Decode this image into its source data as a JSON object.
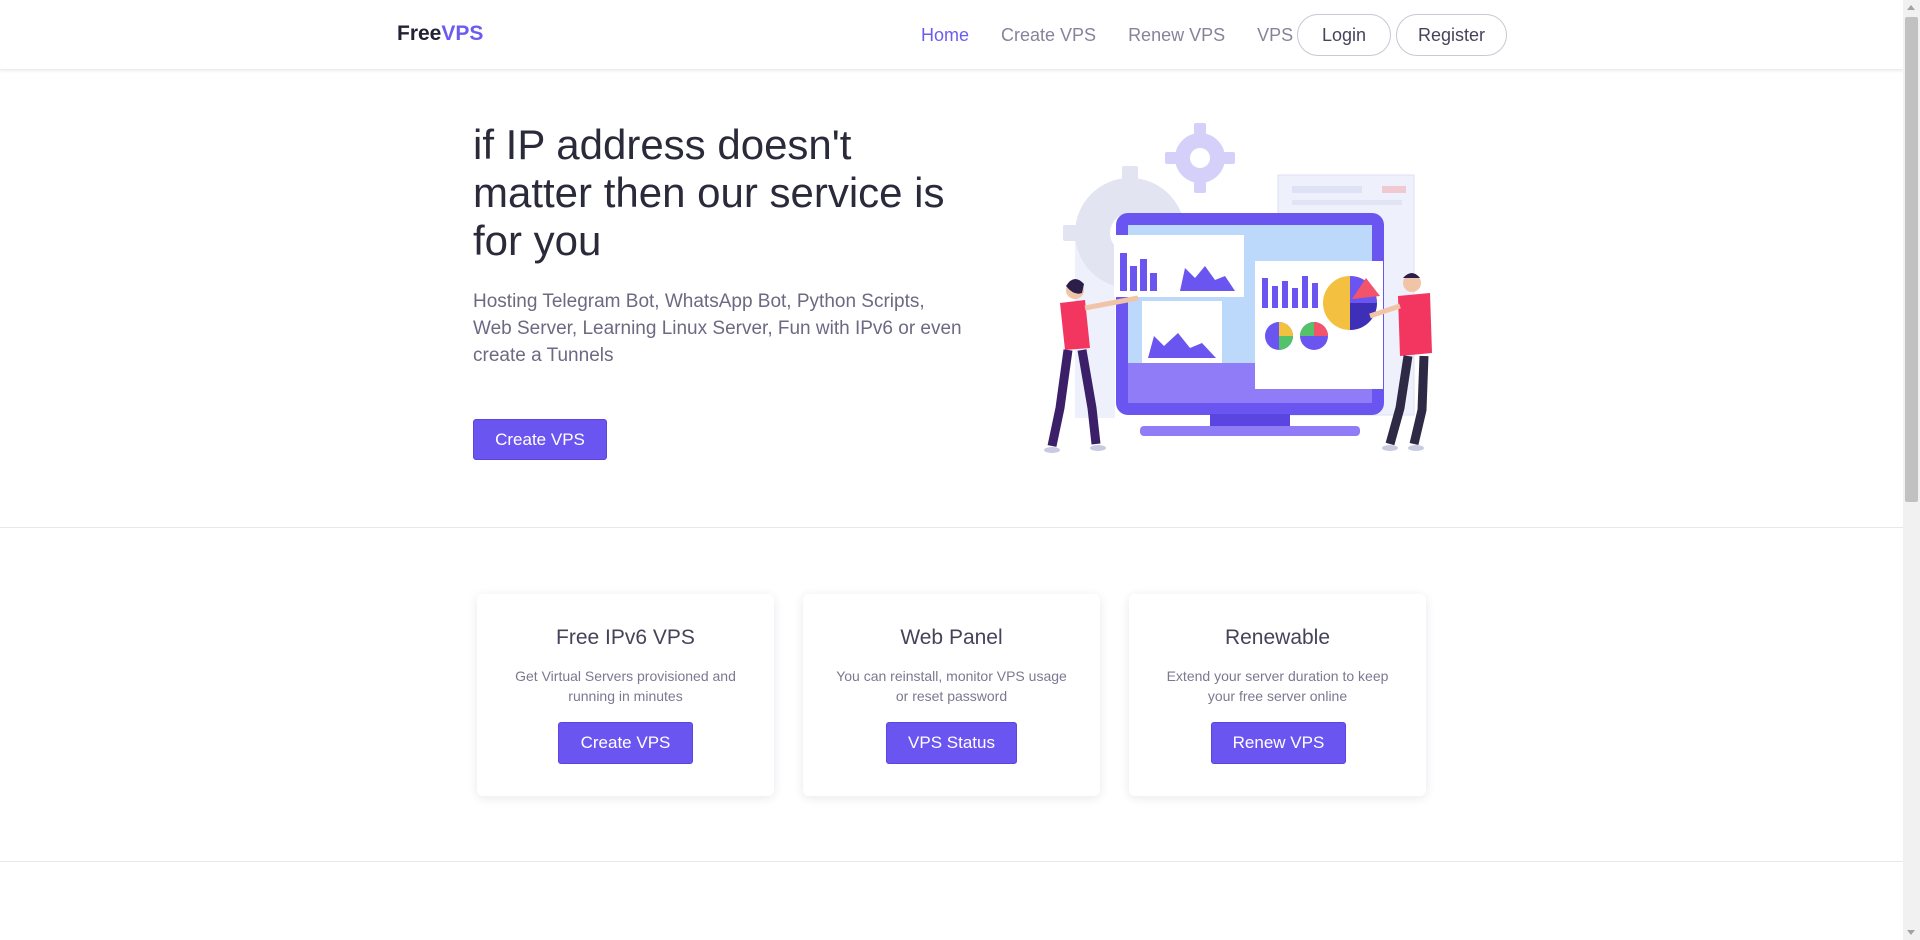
{
  "brand": {
    "part1": "Free",
    "part2": "VPS"
  },
  "nav": {
    "links": [
      {
        "label": "Home",
        "active": true
      },
      {
        "label": "Create VPS",
        "active": false
      },
      {
        "label": "Renew VPS",
        "active": false
      },
      {
        "label": "VPS",
        "active": false,
        "dropdown": true
      }
    ],
    "login": "Login",
    "register": "Register"
  },
  "hero": {
    "title": "if IP address doesn't matter then our service is for you",
    "subtitle": "Hosting Telegram Bot, WhatsApp Bot, Python Scripts, Web Server, Learning Linux Server, Fun with IPv6 or even create a Tunnels",
    "cta": "Create VPS",
    "illustration_icon": "analytics-dashboard-illustration"
  },
  "features": [
    {
      "title": "Free IPv6 VPS",
      "desc": "Get Virtual Servers provisioned and running in minutes",
      "button": "Create VPS"
    },
    {
      "title": "Web Panel",
      "desc": "You can reinstall, monitor VPS usage or reset password",
      "button": "VPS Status"
    },
    {
      "title": "Renewable",
      "desc": "Extend your server duration to keep your free server online",
      "button": "Renew VPS"
    }
  ],
  "colors": {
    "accent": "#6b55f0",
    "brand_accent": "#6b5cf0",
    "text_muted": "#86849a"
  }
}
